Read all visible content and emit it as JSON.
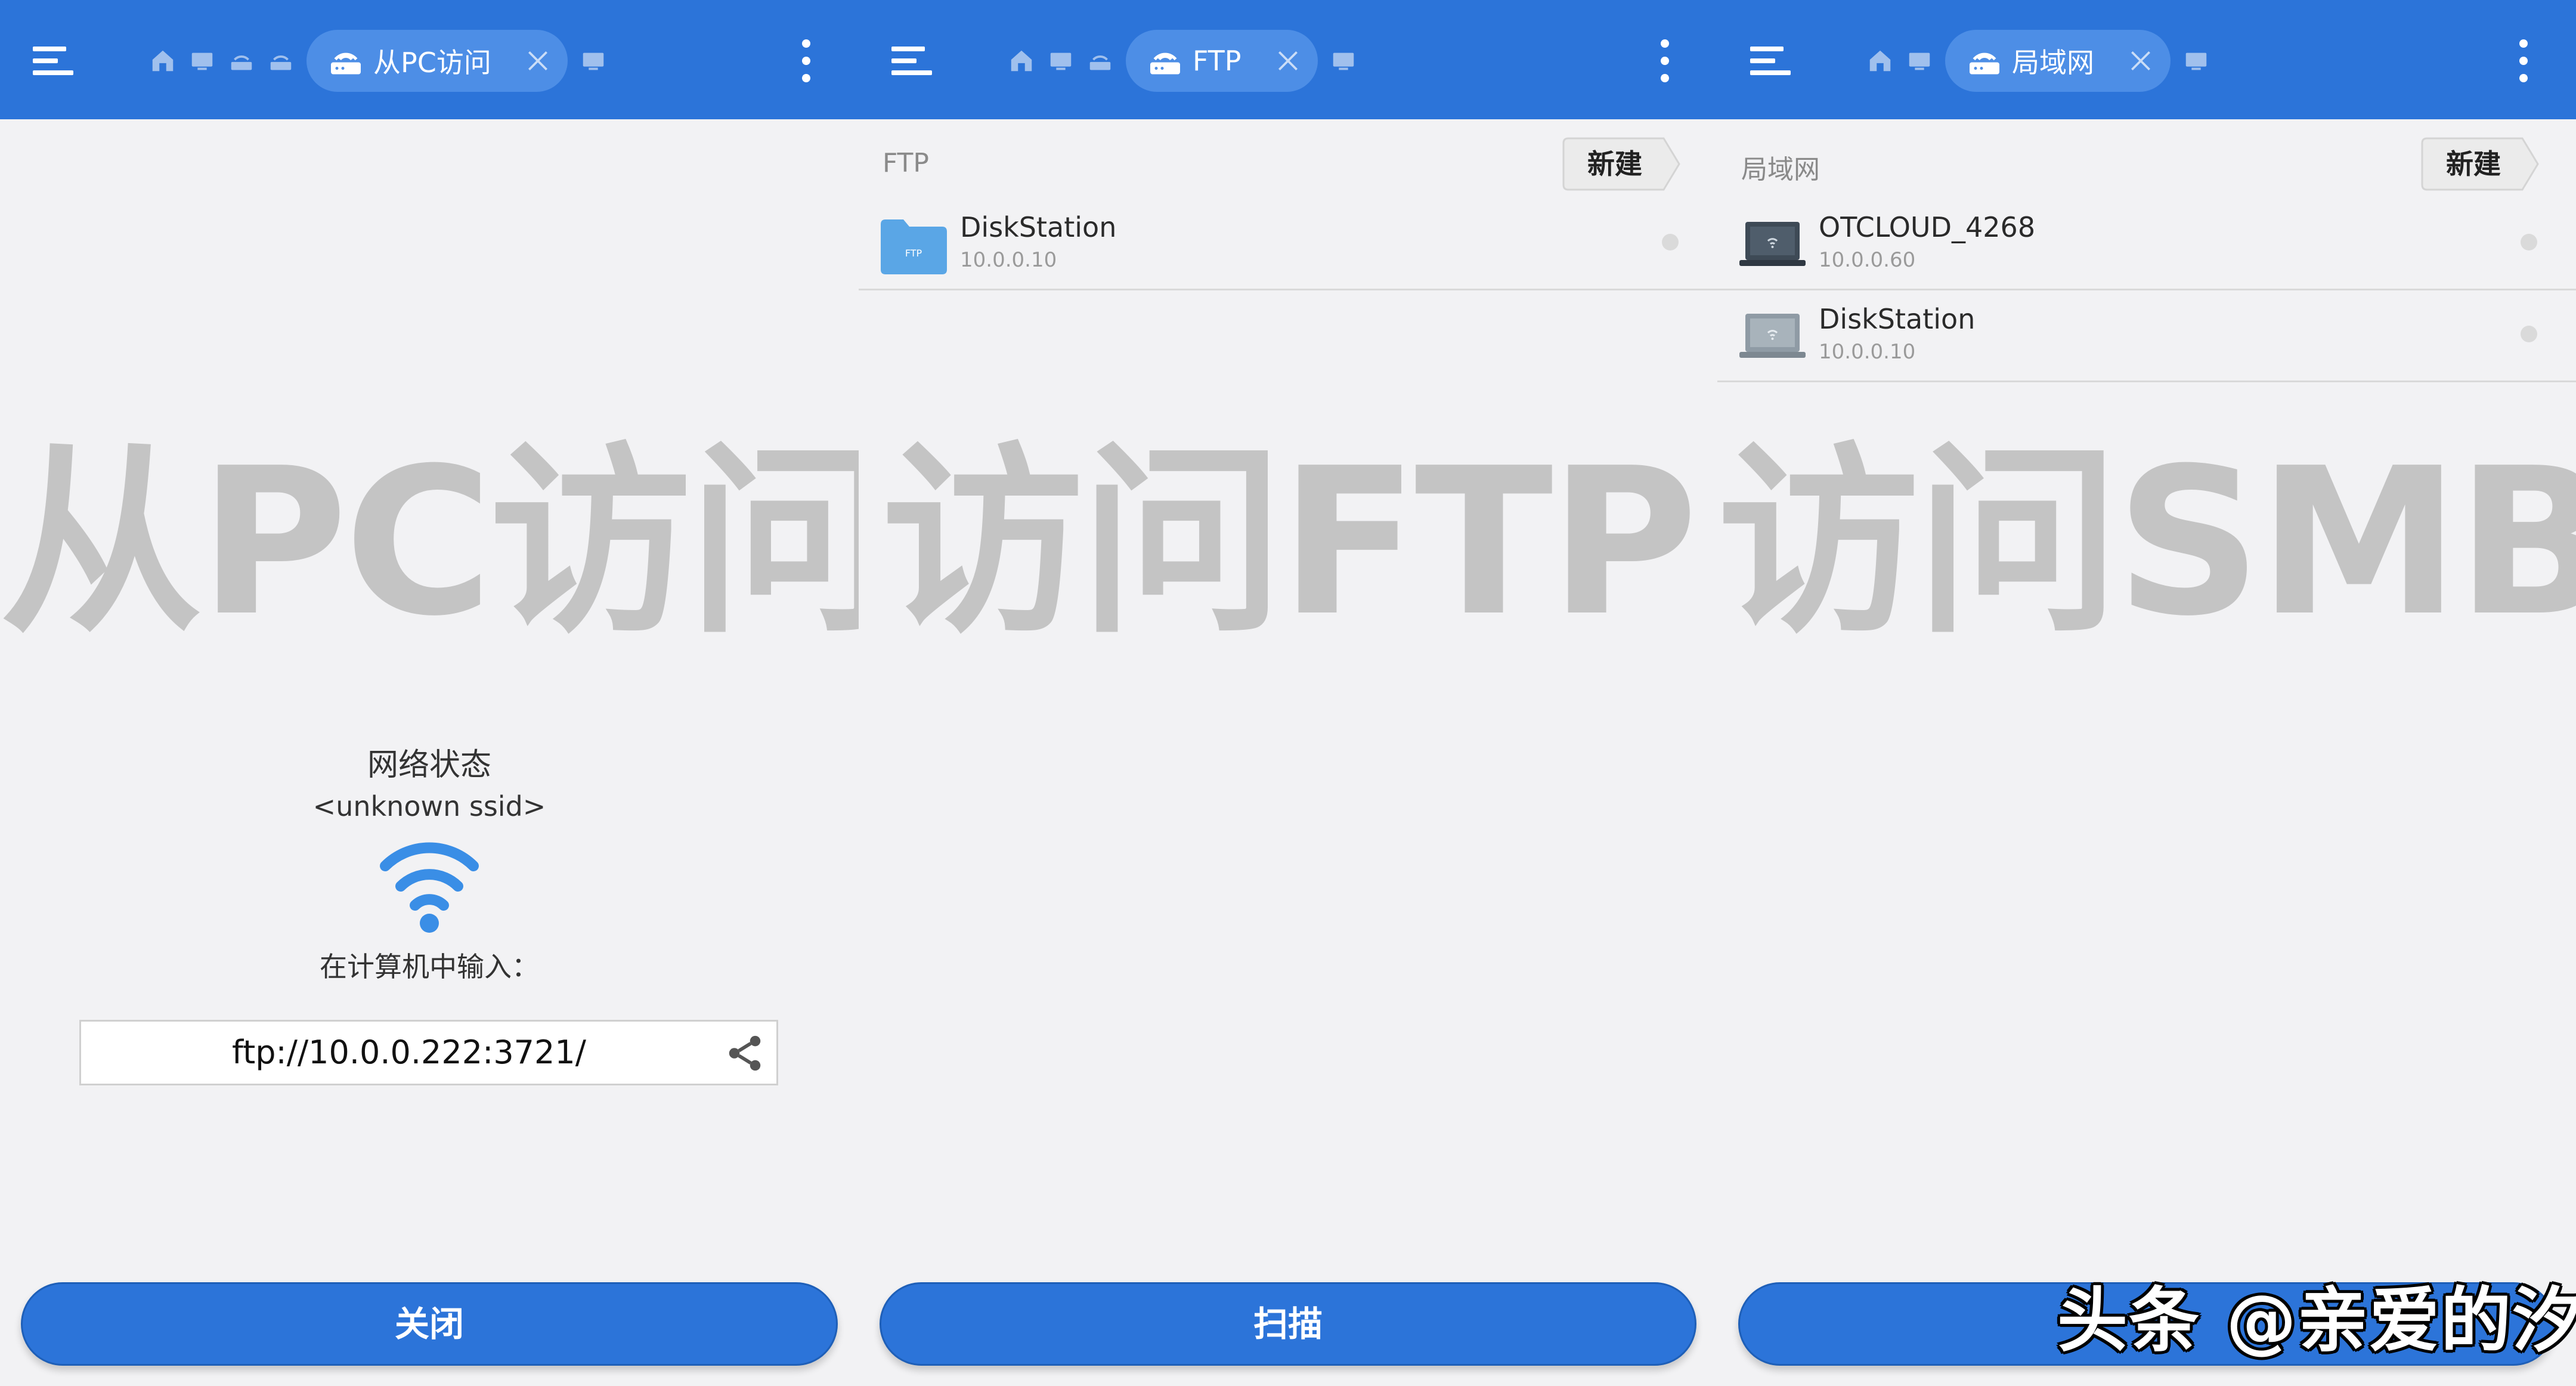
{
  "panels": [
    {
      "tab_label": "从PC访问",
      "watermark": "从PC访问",
      "network": {
        "status_label": "网络状态",
        "ssid": "<unknown ssid>",
        "input_hint": "在计算机中输入：",
        "url": "ftp://10.0.0.222:3721/"
      },
      "bottom_button": "关闭"
    },
    {
      "tab_label": "FTP",
      "section_title": "FTP",
      "new_button": "新建",
      "watermark": "访问FTP",
      "items": [
        {
          "name": "DiskStation",
          "ip": "10.0.0.10",
          "icon": "ftp-folder-icon"
        }
      ],
      "bottom_button": "扫描"
    },
    {
      "tab_label": "局域网",
      "section_title": "局域网",
      "new_button": "新建",
      "watermark": "访问SMB",
      "items": [
        {
          "name": "OTCLOUD_4268",
          "ip": "10.0.0.60",
          "icon": "laptop-dark-icon"
        },
        {
          "name": "DiskStation",
          "ip": "10.0.0.10",
          "icon": "laptop-gray-icon"
        }
      ],
      "bottom_button": ""
    }
  ],
  "credit": "头条 @亲爱的汐",
  "colors": {
    "accent": "#2c74d9",
    "chip": "#4d8ee6",
    "background": "#f2f2f4",
    "watermark": "#c4c4c4",
    "wifi": "#3a8ee6"
  }
}
